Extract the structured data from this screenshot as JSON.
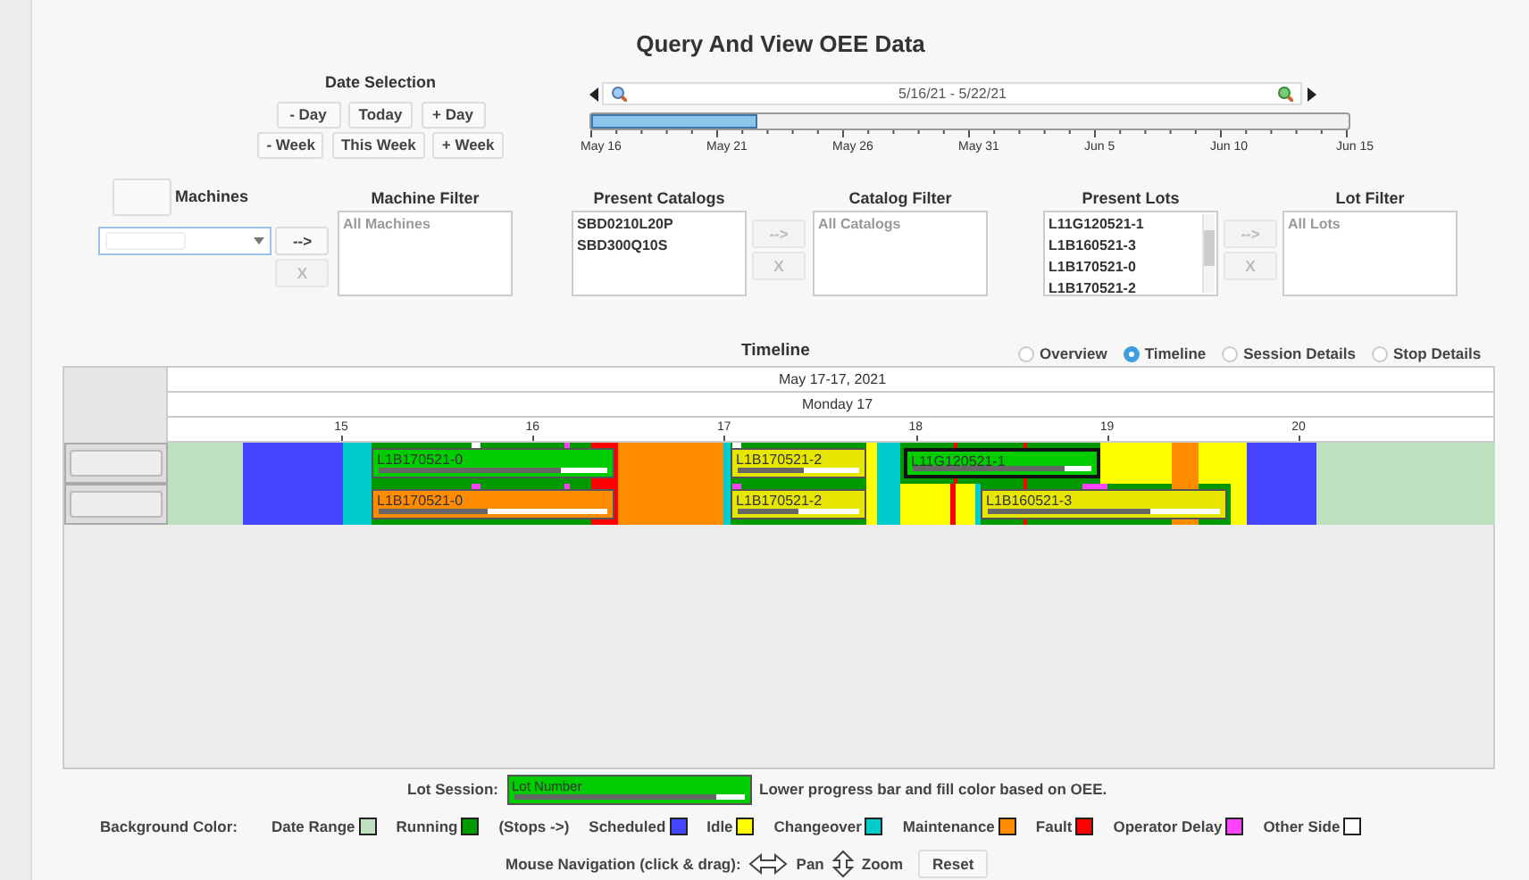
{
  "title": "Query And View OEE Data",
  "date_selection": {
    "label": "Date Selection",
    "buttons": [
      [
        "- Day",
        "Today",
        "+ Day"
      ],
      [
        "- Week",
        "This Week",
        "+ Week"
      ]
    ]
  },
  "date_slider": {
    "range_text": "5/16/21 - 5/22/21",
    "level": 0.22,
    "ticks": [
      "May 16",
      "May 21",
      "May 26",
      "May 31",
      "Jun 5",
      "Jun 10",
      "Jun 15"
    ]
  },
  "filters": [
    {
      "kind": "machines",
      "label": "Machines",
      "buttons": [
        {
          "label": "-->",
          "disabled": false
        },
        {
          "label": "X",
          "disabled": true
        }
      ]
    },
    {
      "kind": "list",
      "label": "Machine Filter",
      "placeholder": "All Machines"
    },
    {
      "kind": "list",
      "label": "Present Catalogs",
      "items": [
        "SBD0210L20P",
        "SBD300Q10S"
      ],
      "buttons": [
        {
          "label": "-->",
          "disabled": true
        },
        {
          "label": "X",
          "disabled": true
        }
      ]
    },
    {
      "kind": "list",
      "label": "Catalog Filter",
      "placeholder": "All Catalogs"
    },
    {
      "kind": "list",
      "label": "Present Lots",
      "items": [
        "L11G120521-1",
        "L1B160521-3",
        "L1B170521-0",
        "L1B170521-2"
      ],
      "scrollbar": true,
      "buttons": [
        {
          "label": "-->",
          "disabled": true
        },
        {
          "label": "X",
          "disabled": true
        }
      ]
    },
    {
      "kind": "list",
      "label": "Lot Filter",
      "placeholder": "All Lots"
    }
  ],
  "timeline": {
    "title": "Timeline",
    "views": [
      {
        "label": "Overview",
        "selected": false
      },
      {
        "label": "Timeline",
        "selected": true
      },
      {
        "label": "Session Details",
        "selected": false
      },
      {
        "label": "Stop Details",
        "selected": false
      }
    ],
    "date_header": "May 17-17, 2021",
    "day_header": "Monday 17",
    "hours": [
      "15",
      "16",
      "17",
      "18",
      "19",
      "20"
    ],
    "rows": [
      {
        "lots": [
          {
            "label": "L1B170521-0",
            "color": "#00cc00",
            "level": 0.8,
            "highlighted": false
          },
          {
            "label": "L1B170521-2",
            "color": "#e6e600",
            "level": 0.55,
            "highlighted": false
          },
          {
            "label": "L11G120521-1",
            "color": "#00cc00",
            "level": 0.85,
            "highlighted": true
          }
        ]
      },
      {
        "lots": [
          {
            "label": "L1B170521-0",
            "color": "#ff8c00",
            "level": 0.48,
            "highlighted": false
          },
          {
            "label": "L1B170521-2",
            "color": "#e6e600",
            "level": 0.5,
            "highlighted": false
          },
          {
            "label": "L1B160521-3",
            "color": "#e6e600",
            "level": 0.7,
            "highlighted": false
          }
        ]
      }
    ]
  },
  "legend": {
    "lot_session": {
      "label": "Lot Session:",
      "sample": "Lot Number",
      "level": 0.88,
      "note": "Lower progress bar and fill color based on OEE."
    },
    "background_label": "Background Color:",
    "items": [
      {
        "kind": "swatch",
        "label": "Date Range",
        "color": "#bfe0bf"
      },
      {
        "kind": "swatch",
        "label": "Running",
        "color": "#009900"
      },
      {
        "kind": "note",
        "label": "(Stops ->)"
      },
      {
        "kind": "swatch",
        "label": "Scheduled",
        "color": "#4444ff"
      },
      {
        "kind": "swatch",
        "label": "Idle",
        "color": "#ffff00"
      },
      {
        "kind": "swatch",
        "label": "Changeover",
        "color": "#00cccc"
      },
      {
        "kind": "swatch",
        "label": "Maintenance",
        "color": "#ff8c00"
      },
      {
        "kind": "swatch",
        "label": "Fault",
        "color": "#ff0000"
      },
      {
        "kind": "swatch",
        "label": "Operator Delay",
        "color": "#ff44ff"
      },
      {
        "kind": "swatch",
        "label": "Other Side",
        "color": "#ffffff"
      }
    ],
    "navigation": {
      "label": "Mouse Navigation (click & drag):",
      "pan": "Pan",
      "zoom": "Zoom",
      "reset": "Reset"
    }
  }
}
